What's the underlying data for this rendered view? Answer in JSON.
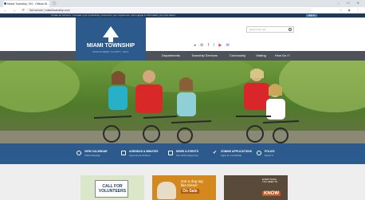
{
  "browser": {
    "tab_title": "Miami Township, OH - Official W...",
    "url": "Not secure  |  miamitownship.com",
    "nav_buttons": "← → ⟳ ⌂",
    "ext_icons": "☆ ◉ ⋮",
    "window_buttons": "– ☐ ✕"
  },
  "notice": {
    "text": "Create an Account - Increase your productivity, customize your experience, and engage in information you care about.",
    "signin_label": "Sign In"
  },
  "logo": {
    "title": "MIAMI TOWNSHIP",
    "subtitle": "MONTGOMERY COUNTY, OHIO"
  },
  "header_tools": {
    "text_smaller": "◂",
    "text_larger": "⚙",
    "facebook": "f",
    "twitter": "t",
    "youtube": "▶",
    "email": "✉",
    "search_placeholder": "Search this site"
  },
  "nav": {
    "items": [
      "Departments",
      "Township Services",
      "Community",
      "Visiting",
      "How Do I?"
    ]
  },
  "quick_links": [
    {
      "title": "VIEW CALENDAR",
      "sub": "Public Meetings",
      "icon": "clock-icon"
    },
    {
      "title": "AGENDAS & MINUTES",
      "sub": "Upcoming & archived",
      "icon": "document-icon"
    },
    {
      "title": "NEWS & EVENTS",
      "sub": "See what's happening",
      "icon": "newspaper-icon"
    },
    {
      "title": "ZONING APPLICATIONS",
      "sub": "Apply for a certificate",
      "icon": "check-icon"
    },
    {
      "title": "POLICE",
      "sub": "Report It",
      "icon": "badge-icon"
    }
  ],
  "cards": {
    "card1_text": "CALL FOR VOLUNTEERS",
    "card2_line1": "Get a dog tag",
    "card2_line2": "like these!",
    "card2_sale": "On Sale",
    "card3_text": "EVERYTHING\nYOU NEED TO",
    "card3_know": "KNOW"
  },
  "colors": {
    "brand_blue": "#2d5a8c",
    "nav_gray": "#4c5258",
    "notice_navy": "#1e3a5c"
  }
}
